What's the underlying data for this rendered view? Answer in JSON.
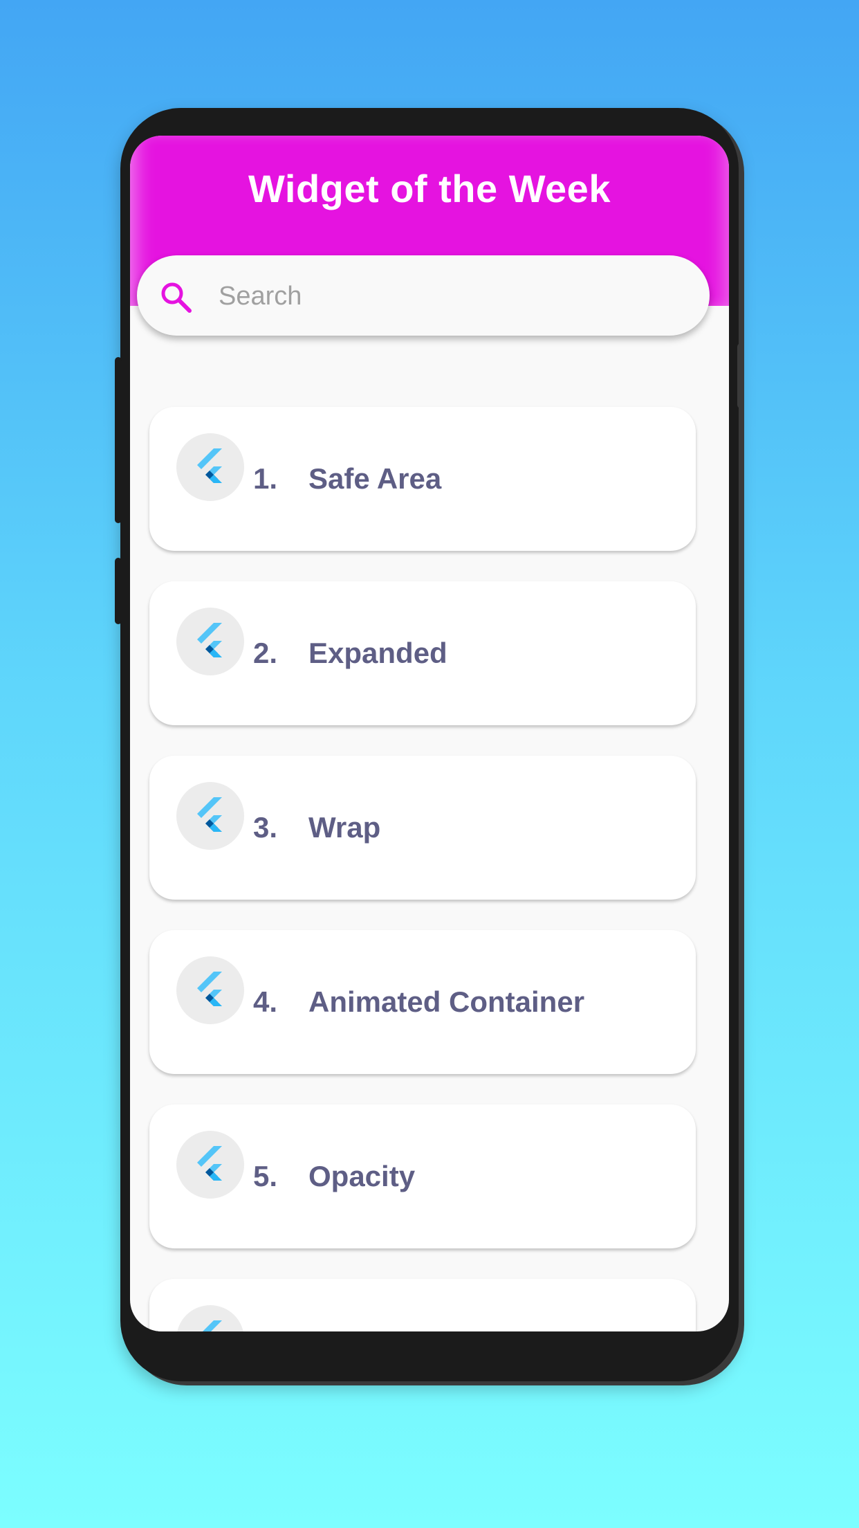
{
  "app": {
    "title": "Widget of the Week"
  },
  "search": {
    "placeholder": "Search",
    "value": ""
  },
  "colors": {
    "header": "#e513e0",
    "accent": "#e513e0",
    "label_text": "#5e5e85",
    "background_top": "#43a6f4",
    "background_bottom": "#7cfeff"
  },
  "widgets": [
    {
      "number": "1.",
      "name": "Safe Area",
      "icon": "flutter-logo-icon"
    },
    {
      "number": "2.",
      "name": "Expanded",
      "icon": "flutter-logo-icon"
    },
    {
      "number": "3.",
      "name": "Wrap",
      "icon": "flutter-logo-icon"
    },
    {
      "number": "4.",
      "name": "Animated Container",
      "icon": "flutter-logo-icon"
    },
    {
      "number": "5.",
      "name": "Opacity",
      "icon": "flutter-logo-icon"
    },
    {
      "number": "",
      "name": "",
      "icon": "flutter-logo-icon"
    }
  ]
}
